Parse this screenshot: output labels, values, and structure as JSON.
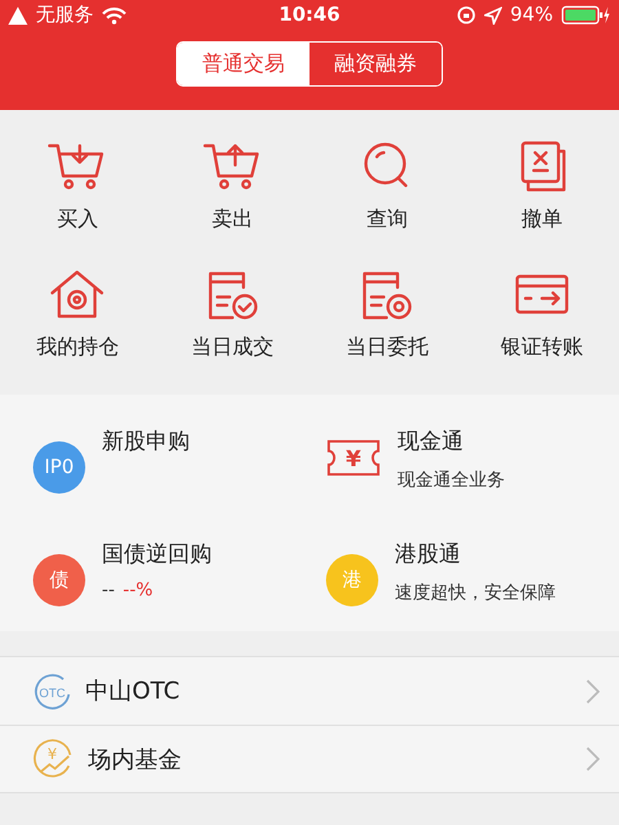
{
  "status_bar": {
    "carrier": "无服务",
    "time": "10:46",
    "battery": "94%"
  },
  "tabs": [
    {
      "label": "普通交易",
      "selected": true
    },
    {
      "label": "融资融券",
      "selected": false
    }
  ],
  "actions": [
    {
      "label": "买入",
      "kind": "cart-in"
    },
    {
      "label": "卖出",
      "kind": "cart-out"
    },
    {
      "label": "查询",
      "kind": "search"
    },
    {
      "label": "撤单",
      "kind": "cancel"
    },
    {
      "label": "我的持仓",
      "kind": "house"
    },
    {
      "label": "当日成交",
      "kind": "doc-check"
    },
    {
      "label": "当日委托",
      "kind": "doc-coin"
    },
    {
      "label": "银证转账",
      "kind": "card"
    }
  ],
  "services": [
    {
      "title": "新股申购",
      "kind": "circle",
      "badge": "IP0",
      "color": "#4a9be8"
    },
    {
      "title": "现金通",
      "kind": "ticket",
      "badge": "¥",
      "subtitle": "现金通全业务"
    },
    {
      "title": "国债逆回购",
      "kind": "circle",
      "badge": "债",
      "color": "#f0604a",
      "value": "--",
      "rate": "--%"
    },
    {
      "title": "港股通",
      "kind": "circle",
      "badge": "港",
      "color": "#f7c31d",
      "subtitle": "速度超快，安全保障"
    }
  ],
  "list": [
    {
      "label": "中山OTC",
      "kind": "otc",
      "badge": "OTC"
    },
    {
      "label": "场内基金",
      "kind": "fund",
      "badge": "¥"
    }
  ]
}
